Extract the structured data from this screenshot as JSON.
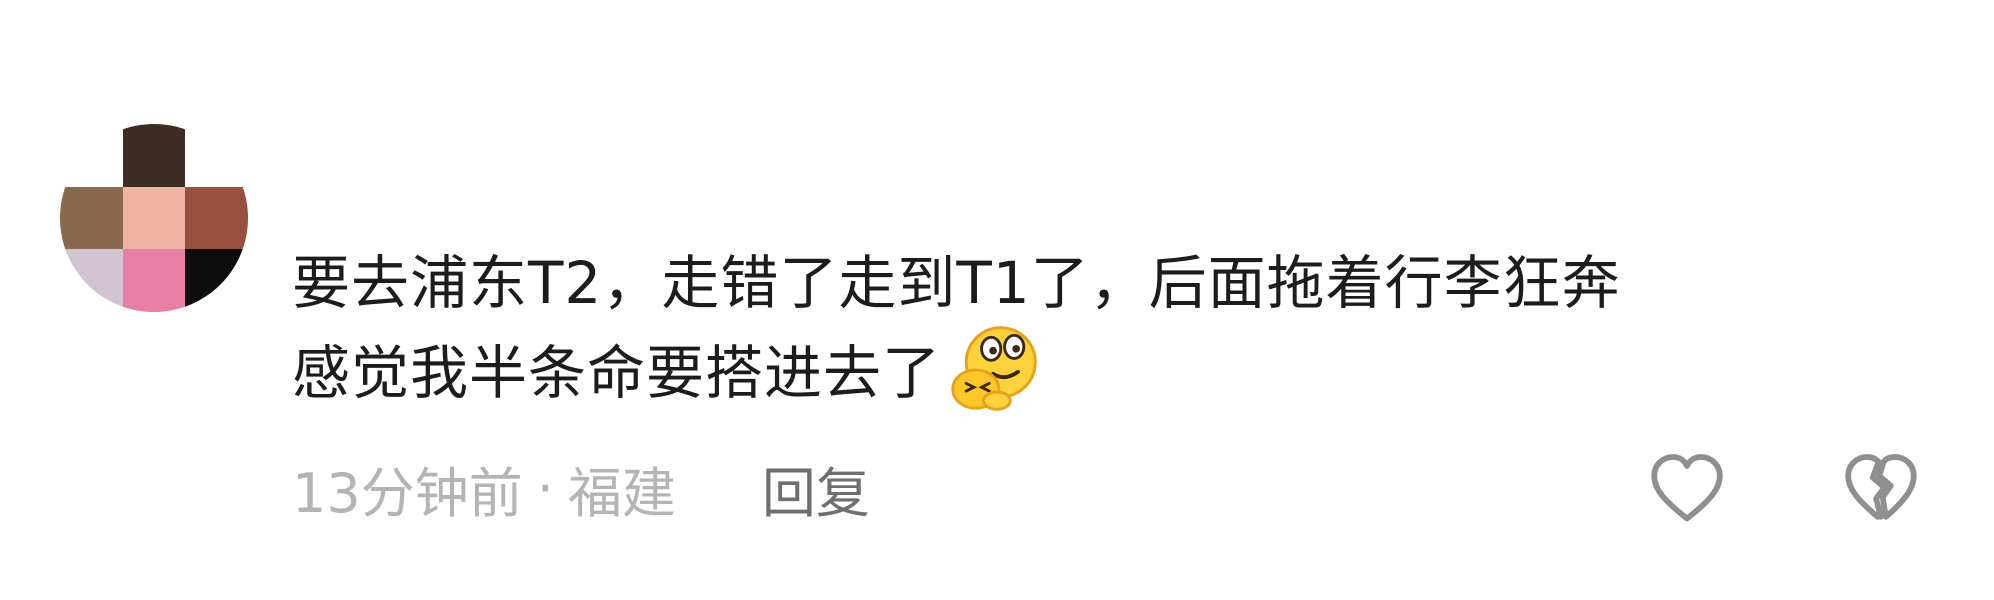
{
  "comment": {
    "avatar": {
      "pixels": [
        [
          "#ffffff",
          "#3d2c23",
          "#ffffff"
        ],
        [
          "#8a6a4f",
          "#f0b3a6",
          "#98503f"
        ],
        [
          "#d2c3d0",
          "#ea7fa5",
          "#0e0d0e"
        ]
      ]
    },
    "text_lines": [
      "要去浦东T2，走错了走到T1了，后面拖着行李狂奔",
      "感觉我半条命要搭进去了"
    ],
    "emoji": "shy-smile-emoji",
    "time": "13分钟前",
    "separator": "·",
    "location": "福建",
    "reply_label": "回复",
    "like_icon": "heart-icon",
    "dislike_icon": "broken-heart-icon"
  }
}
